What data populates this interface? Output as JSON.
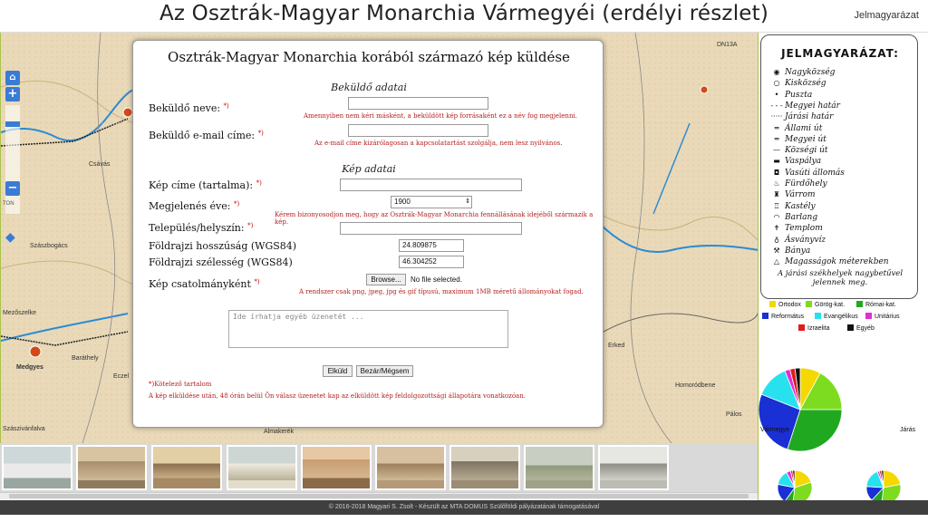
{
  "header": {
    "title": "Az Osztrák-Magyar Monarchia Vármegyéi (erdélyi részlet)",
    "legend_link": "Jelmagyarázat"
  },
  "map": {
    "labels": [
      "Csávás",
      "Szászbogács",
      "Mezőszelke",
      "Baráthely",
      "Medgyes",
      "Eczel",
      "Szászivánfalva",
      "Almakerék",
      "Erked",
      "Homoródbene",
      "Pálos",
      "DN13A"
    ],
    "zoom_in": "+",
    "zoom_out": "−",
    "zoom_text": "TON"
  },
  "dialog": {
    "title": "Osztrák-Magyar Monarchia korából származó kép küldése",
    "section_sender": "Beküldő adatai",
    "sender_name_label": "Beküldő neve:",
    "sender_name_hint": "Amennyiben nem kéri másként, a beküldött kép forrásaként ez a név fog megjelenni.",
    "sender_email_label": "Beküldő e-mail címe:",
    "sender_email_hint": "Az e-mail címe kizárólagosan a kapcsolatartást szolgálja, nem lesz nyilvános.",
    "section_image": "Kép adatai",
    "image_title_label": "Kép címe (tartalma):",
    "year_label": "Megjelenés éve:",
    "year_value": "1900",
    "year_hint": "Kérem bizonyosodjon meg, hogy az Osztrák-Magyar Monarchia fennállásának idejéből származik a kép.",
    "place_label": "Település/helyszín:",
    "lon_label": "Földrajzi hosszúság (WGS84)",
    "lon_value": "24.809875",
    "lat_label": "Földrajzi szélesség (WGS84)",
    "lat_value": "46.304252",
    "attach_label": "Kép csatolmányként",
    "browse_button": "Browse...",
    "no_file": "No file selected.",
    "attach_hint": "A rendszer csak png, jpeg, jpg és gif típusú, maximum 1MB méretű állományokat fogad.",
    "message_placeholder": "Ide írhatja egyéb üzenetét ...",
    "send_button": "Elküld",
    "close_button": "Bezár/Mégsem",
    "required_star": "*)",
    "required_note": "Kötelező tartalom",
    "response_note": "A kép elküldése után, 48 órán belül Ön válasz üzenetet kap az elküldött kép feldolgozottsági állapotára vonatkozóan."
  },
  "legend": {
    "title": "JELMAGYARÁZAT:",
    "items": [
      {
        "symbol": "◉",
        "label": "Nagyközség"
      },
      {
        "symbol": "○",
        "label": "Kisközség"
      },
      {
        "symbol": "•",
        "label": "Puszta"
      },
      {
        "symbol": "- - -",
        "label": "Megyei határ"
      },
      {
        "symbol": "·····",
        "label": "Járási határ"
      },
      {
        "symbol": "═",
        "label": "Állami út"
      },
      {
        "symbol": "═",
        "label": "Megyei út"
      },
      {
        "symbol": "—",
        "label": "Községi út"
      },
      {
        "symbol": "▬",
        "label": "Vaspálya"
      },
      {
        "symbol": "◘",
        "label": "Vasúti állomás"
      },
      {
        "symbol": "♨",
        "label": "Fürdőhely"
      },
      {
        "symbol": "♜",
        "label": "Várrom"
      },
      {
        "symbol": "♖",
        "label": "Kastély"
      },
      {
        "symbol": "◠",
        "label": "Barlang"
      },
      {
        "symbol": "✝",
        "label": "Templom"
      },
      {
        "symbol": "♁",
        "label": "Ásványvíz"
      },
      {
        "symbol": "⚒",
        "label": "Bánya"
      },
      {
        "symbol": "△",
        "label": "Magasságok méterekben"
      }
    ],
    "note": "A járási székhelyek nagybetűvel jelennek meg."
  },
  "religions": [
    {
      "name": "Ortodox",
      "color": "#f5d800"
    },
    {
      "name": "Görög-kat.",
      "color": "#7ddc1f"
    },
    {
      "name": "Római-kat.",
      "color": "#21a821"
    },
    {
      "name": "Református",
      "color": "#1a2fd4"
    },
    {
      "name": "Evangélikus",
      "color": "#27e1ee"
    },
    {
      "name": "Unitárius",
      "color": "#e12fd6"
    },
    {
      "name": "Izraelita",
      "color": "#e01c1c"
    },
    {
      "name": "Egyéb",
      "color": "#111111"
    }
  ],
  "pie_labels": {
    "county": "Vármegye",
    "district": "Járás"
  },
  "chart_data": [
    {
      "type": "pie",
      "categories": [
        "Ortodox",
        "Görög-kat.",
        "Római-kat.",
        "Református",
        "Evangélikus",
        "Unitárius",
        "Izraelita",
        "Egyéb"
      ],
      "values": [
        8,
        17,
        30,
        26,
        13,
        2,
        2,
        2
      ]
    },
    {
      "type": "pie",
      "categories": [
        "Ortodox",
        "Görög-kat.",
        "Római-kat.",
        "Református",
        "Evangélikus",
        "Unitárius",
        "Izraelita",
        "Egyéb"
      ],
      "values": [
        20,
        32,
        8,
        18,
        14,
        4,
        2,
        2
      ]
    },
    {
      "type": "pie",
      "categories": [
        "Ortodox",
        "Görög-kat.",
        "Római-kat.",
        "Református",
        "Evangélikus",
        "Unitárius",
        "Izraelita",
        "Egyéb"
      ],
      "values": [
        22,
        30,
        10,
        14,
        18,
        2,
        2,
        2
      ]
    }
  ],
  "footer": "© 2016-2018 Magyari S. Zsolt - Készült az MTA DOMUS Szülőföldi pályázatának támogatásával"
}
